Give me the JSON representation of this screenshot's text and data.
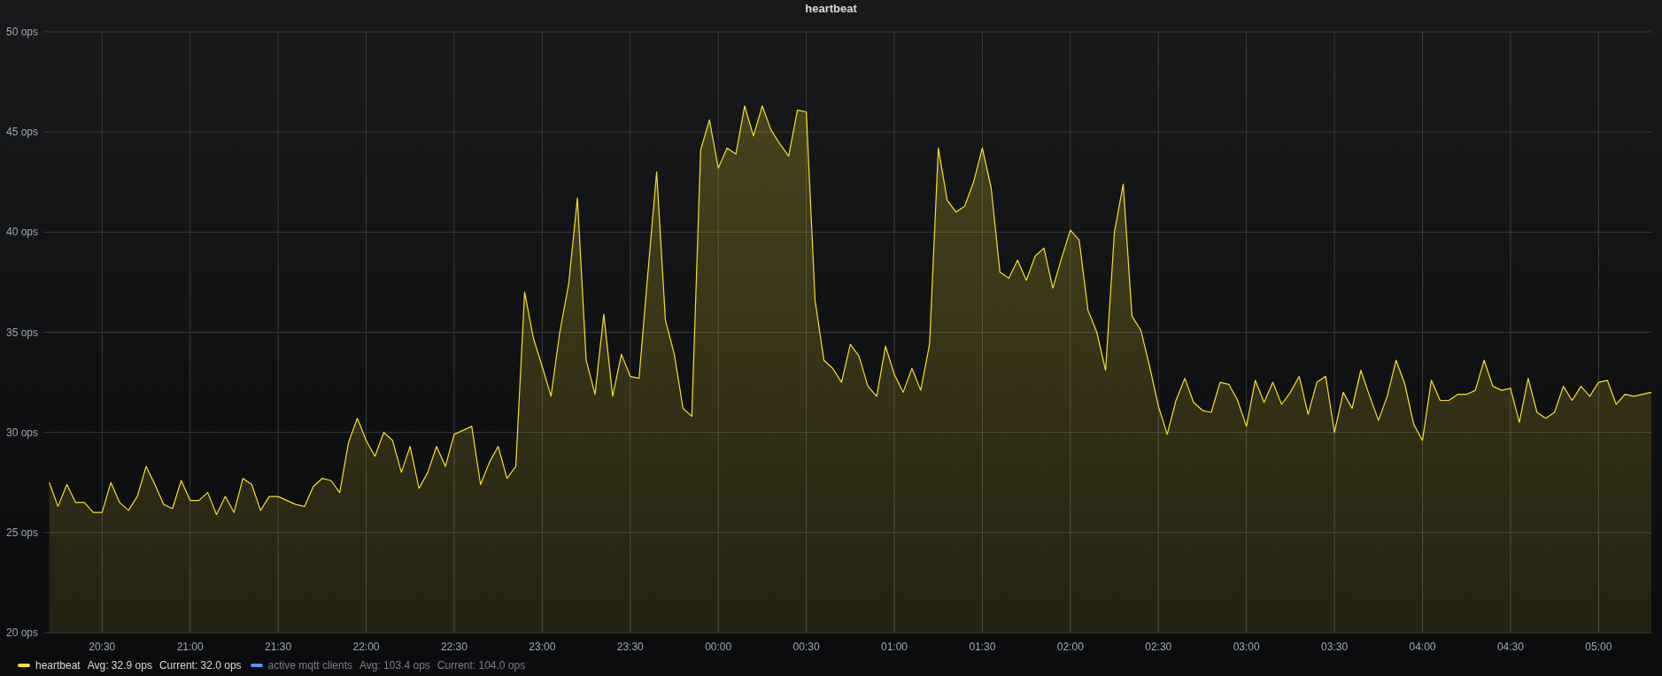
{
  "panel": {
    "title": "heartbeat"
  },
  "chart_data": {
    "type": "area",
    "grid": true,
    "ylim": [
      20,
      50
    ],
    "yticks": [
      {
        "value": 20,
        "label": "20 ops"
      },
      {
        "value": 25,
        "label": "25 ops"
      },
      {
        "value": 30,
        "label": "30 ops"
      },
      {
        "value": 35,
        "label": "35 ops"
      },
      {
        "value": 40,
        "label": "40 ops"
      },
      {
        "value": 45,
        "label": "45 ops"
      },
      {
        "value": 50,
        "label": "50 ops"
      }
    ],
    "categories": [
      null,
      null,
      null,
      null,
      null,
      null,
      "20:30",
      null,
      null,
      null,
      null,
      null,
      null,
      null,
      null,
      null,
      "21:00",
      null,
      null,
      null,
      null,
      null,
      null,
      null,
      null,
      null,
      "21:30",
      null,
      null,
      null,
      null,
      null,
      null,
      null,
      null,
      null,
      "22:00",
      null,
      null,
      null,
      null,
      null,
      null,
      null,
      null,
      null,
      "22:30",
      null,
      null,
      null,
      null,
      null,
      null,
      null,
      null,
      null,
      "23:00",
      null,
      null,
      null,
      null,
      null,
      null,
      null,
      null,
      null,
      "23:30",
      null,
      null,
      null,
      null,
      null,
      null,
      null,
      null,
      null,
      "00:00",
      null,
      null,
      null,
      null,
      null,
      null,
      null,
      null,
      null,
      "00:30",
      null,
      null,
      null,
      null,
      null,
      null,
      null,
      null,
      null,
      "01:00",
      null,
      null,
      null,
      null,
      null,
      null,
      null,
      null,
      null,
      "01:30",
      null,
      null,
      null,
      null,
      null,
      null,
      null,
      null,
      null,
      "02:00",
      null,
      null,
      null,
      null,
      null,
      null,
      null,
      null,
      null,
      "02:30",
      null,
      null,
      null,
      null,
      null,
      null,
      null,
      null,
      null,
      "03:00",
      null,
      null,
      null,
      null,
      null,
      null,
      null,
      null,
      null,
      "03:30",
      null,
      null,
      null,
      null,
      null,
      null,
      null,
      null,
      null,
      "04:00",
      null,
      null,
      null,
      null,
      null,
      null,
      null,
      null,
      null,
      "04:30",
      null,
      null,
      null,
      null,
      null,
      null,
      null,
      null,
      null,
      "05:00",
      null,
      null,
      null,
      null,
      null,
      null
    ],
    "series": [
      {
        "color": "#fade2a",
        "values": [
          27.5,
          26.3,
          27.4,
          26.5,
          26.5,
          26.0,
          26.0,
          27.5,
          26.5,
          26.1,
          26.8,
          28.3,
          27.4,
          26.4,
          26.2,
          27.6,
          26.6,
          26.6,
          27.0,
          25.9,
          26.8,
          26.0,
          27.7,
          27.4,
          26.1,
          26.8,
          26.8,
          26.6,
          26.4,
          26.3,
          27.3,
          27.7,
          27.6,
          27.0,
          29.5,
          30.7,
          29.6,
          28.8,
          30.0,
          29.6,
          28.0,
          29.3,
          27.2,
          28.0,
          29.3,
          28.3,
          29.9,
          30.1,
          30.3,
          27.4,
          28.5,
          29.3,
          27.7,
          28.3,
          37.0,
          34.7,
          33.3,
          31.8,
          35.0,
          37.4,
          41.7,
          33.6,
          31.9,
          35.9,
          31.8,
          33.9,
          32.8,
          32.7,
          37.9,
          43.0,
          35.6,
          33.9,
          31.2,
          30.8,
          44.1,
          45.6,
          43.2,
          44.2,
          43.9,
          46.3,
          44.8,
          46.3,
          45.1,
          44.4,
          43.8,
          46.1,
          46.0,
          36.6,
          33.6,
          33.2,
          32.5,
          34.4,
          33.8,
          32.3,
          31.8,
          34.3,
          32.9,
          32.0,
          33.2,
          32.1,
          34.4,
          44.2,
          41.6,
          41.0,
          41.3,
          42.5,
          44.2,
          42.2,
          38.0,
          37.7,
          38.6,
          37.6,
          38.8,
          39.2,
          37.2,
          38.7,
          40.1,
          39.6,
          36.1,
          35.0,
          33.1,
          40.0,
          42.4,
          35.8,
          35.1,
          33.3,
          31.3,
          29.9,
          31.6,
          32.7,
          31.5,
          31.1,
          31.0,
          32.5,
          32.4,
          31.6,
          30.3,
          32.6,
          31.5,
          32.5,
          31.4,
          32.0,
          32.8,
          30.9,
          32.5,
          32.8,
          30.0,
          32.0,
          31.2,
          33.1,
          31.8,
          30.6,
          31.8,
          33.6,
          32.4,
          30.4,
          29.6,
          32.6,
          31.6,
          31.6,
          31.9,
          31.9,
          32.1,
          33.6,
          32.3,
          32.1,
          32.2,
          30.5,
          32.7,
          31.0,
          30.7,
          31.0,
          32.3,
          31.6,
          32.3,
          31.8,
          32.5,
          32.6,
          31.4,
          31.9,
          31.8,
          31.9,
          32.0
        ]
      }
    ]
  },
  "legend": [
    {
      "name": "heartbeat",
      "color": "#fade2a",
      "avg": "Avg: 32.9 ops",
      "current": "Current: 32.0 ops",
      "hidden": false
    },
    {
      "name": "active mqtt clients",
      "color": "#5794f2",
      "avg": "Avg: 103.4 ops",
      "current": "Current: 104.0 ops",
      "hidden": true
    }
  ]
}
